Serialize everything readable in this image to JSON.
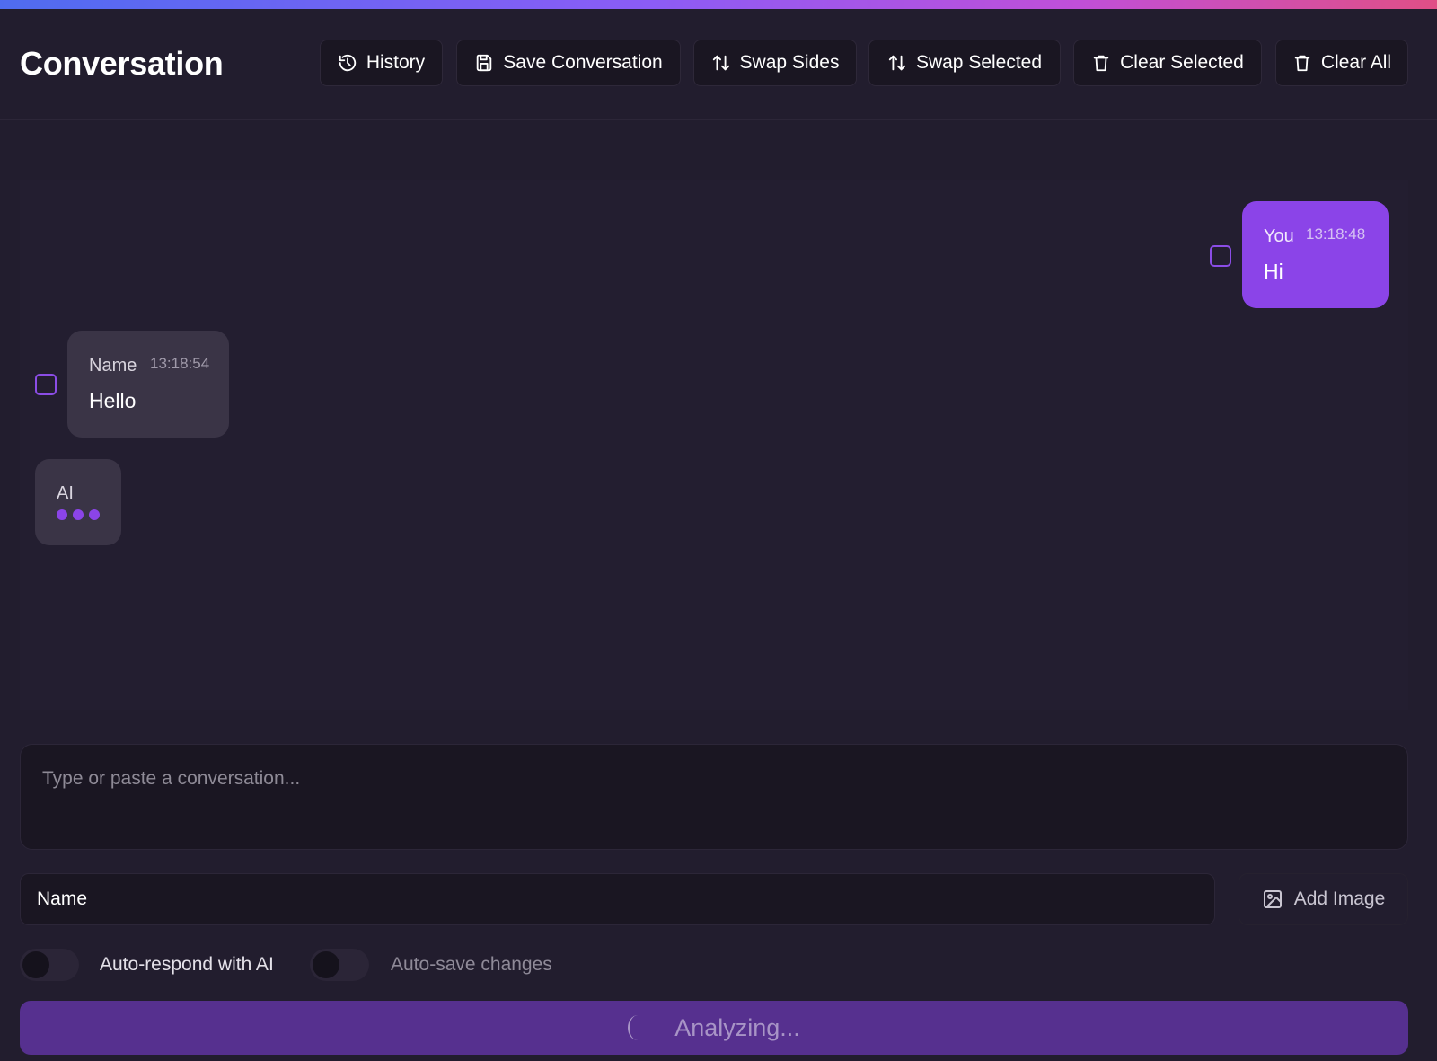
{
  "header": {
    "title": "Conversation",
    "buttons": {
      "history": "History",
      "save": "Save Conversation",
      "swap_sides": "Swap Sides",
      "swap_selected": "Swap Selected",
      "clear_selected": "Clear Selected",
      "clear_all": "Clear All"
    },
    "icons": {
      "history": "history-icon",
      "save": "save-icon",
      "swap": "swap-vertical-icon",
      "trash": "trash-icon"
    }
  },
  "messages": [
    {
      "side": "right",
      "sender": "You",
      "time": "13:18:48",
      "text": "Hi"
    },
    {
      "side": "left",
      "sender": "Name",
      "time": "13:18:54",
      "text": "Hello"
    }
  ],
  "typing": {
    "sender": "AI",
    "indicator": "typing-dots"
  },
  "composer": {
    "placeholder": "Type or paste a conversation...",
    "name_value": "Name",
    "add_image_label": "Add Image",
    "add_image_icon": "image-icon"
  },
  "toggles": [
    {
      "label": "Auto-respond with AI",
      "on": false
    },
    {
      "label": "Auto-save changes",
      "on": false
    }
  ],
  "analyze": {
    "label": "Analyzing...",
    "loading": true
  },
  "colors": {
    "accent": "#8b44e8",
    "background": "#221d2e",
    "bubble_other": "#3a3446",
    "analyze_button": "#56308f"
  }
}
